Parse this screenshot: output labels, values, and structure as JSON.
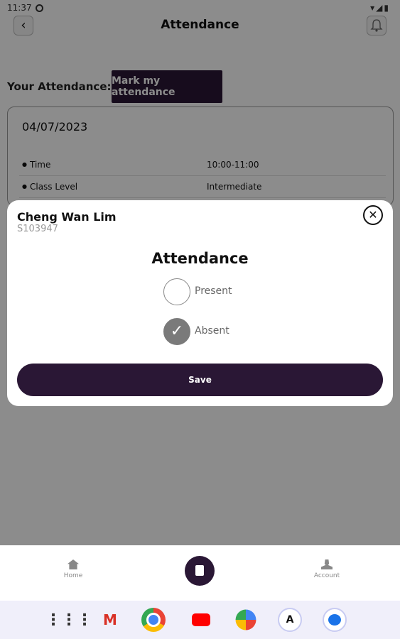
{
  "status": {
    "time": "11:37",
    "right_icons": "▾◢▮"
  },
  "appbar": {
    "title": "Attendance",
    "back_icon": "‹"
  },
  "your_attendance_label": "Your Attendance: -",
  "mark_button": "Mark my attendance",
  "session": {
    "date": "04/07/2023",
    "rows": [
      {
        "key": "Time",
        "value": "10:00-11:00"
      },
      {
        "key": "Class Level",
        "value": "Intermediate"
      }
    ]
  },
  "dialog": {
    "student_name": "Cheng Wan Lim",
    "student_id": "S103947",
    "close_icon": "✕",
    "title": "Attendance",
    "options": [
      {
        "label": "Present",
        "selected": false
      },
      {
        "label": "Absent",
        "selected": true
      }
    ],
    "check_icon": "✓",
    "save_label": "Save"
  },
  "nav": {
    "home_label": "Home",
    "account_label": "Account"
  },
  "dock": {
    "apps_icon": "⋮⋮⋮",
    "gmail_icon": "M",
    "app6_icon": "A"
  },
  "colors": {
    "primary": "#2a1735",
    "scrim": "rgba(0,0,0,0.45)"
  }
}
